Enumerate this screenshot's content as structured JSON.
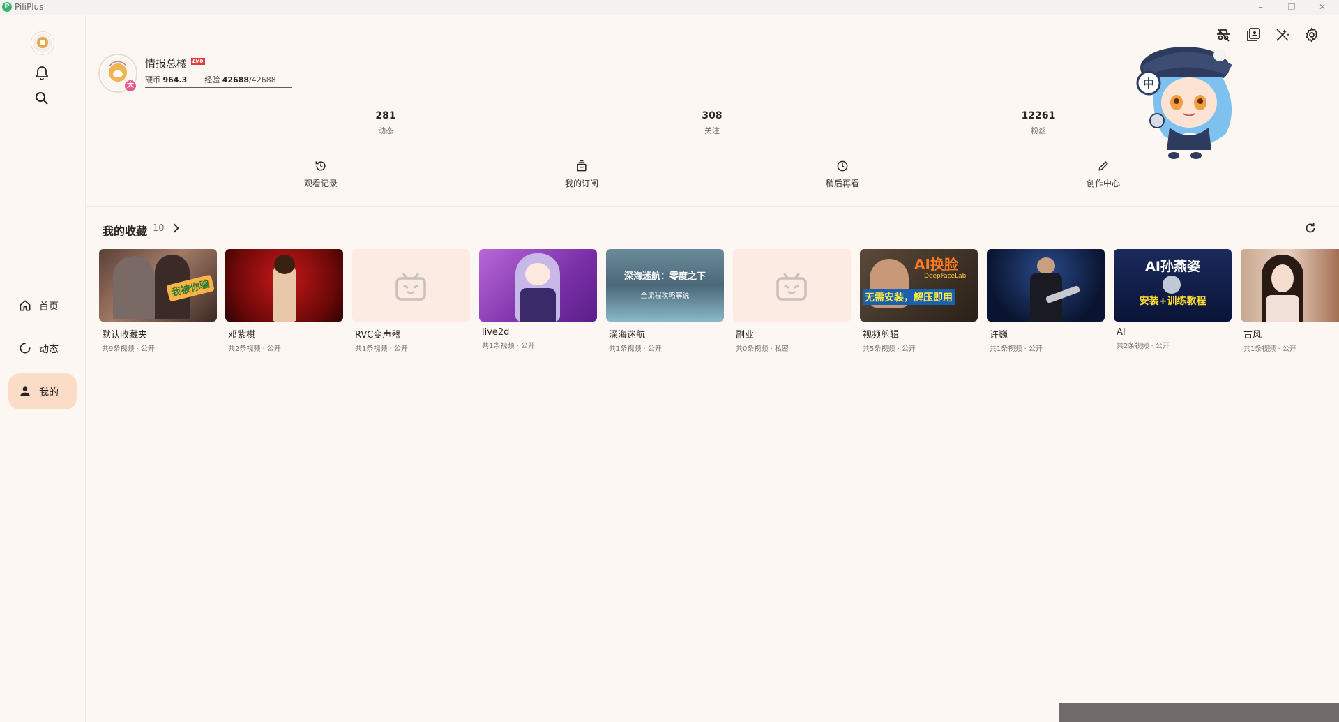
{
  "window": {
    "title": "PiliPlus"
  },
  "sidebar": {
    "nav": [
      {
        "label": "首页",
        "icon": "home-icon"
      },
      {
        "label": "动态",
        "icon": "dynamic-icon"
      },
      {
        "label": "我的",
        "icon": "person-icon",
        "active": true
      }
    ]
  },
  "profile": {
    "name": "情报总橘",
    "level_badge": "LV6",
    "avatar_badge": "大",
    "coins_label": "硬币",
    "coins": "964.3",
    "exp_label": "经验",
    "exp_current": "42688",
    "exp_total": "/42688",
    "exp_progress": 1.0
  },
  "stats": [
    {
      "value": "281",
      "label": "动态"
    },
    {
      "value": "308",
      "label": "关注"
    },
    {
      "value": "12261",
      "label": "粉丝"
    }
  ],
  "quick_actions": [
    {
      "label": "观看记录",
      "icon": "history-icon"
    },
    {
      "label": "我的订阅",
      "icon": "subscription-icon"
    },
    {
      "label": "稍后再看",
      "icon": "clock-icon"
    },
    {
      "label": "创作中心",
      "icon": "pencil-icon"
    }
  ],
  "favorites": {
    "title": "我的收藏",
    "count": "10",
    "items": [
      {
        "title": "默认收藏夹",
        "subtitle": "共9条视频 · 公开"
      },
      {
        "title": "邓紫棋",
        "subtitle": "共2条视频 · 公开"
      },
      {
        "title": "RVC变声器",
        "subtitle": "共1条视频 · 公开"
      },
      {
        "title": "live2d",
        "subtitle": "共1条视频 · 公开"
      },
      {
        "title": "深海迷航",
        "subtitle": "共1条视频 · 公开"
      },
      {
        "title": "副业",
        "subtitle": "共0条视频 · 私密"
      },
      {
        "title": "视频剪辑",
        "subtitle": "共5条视频 · 公开"
      },
      {
        "title": "许巍",
        "subtitle": "共1条视频 · 公开"
      },
      {
        "title": "AI",
        "subtitle": "共2条视频 · 公开"
      },
      {
        "title": "古风",
        "subtitle": "共1条视频 · 公开"
      }
    ],
    "thumb_texts": {
      "t1": "我被你骗",
      "t5a": "深海迷航：零度之下",
      "t5b": "全流程攻略解说",
      "t7a": "AI换脸",
      "t7b": "DeepFaceLab",
      "t7c": "无需安装，解压即用",
      "t9a": "AI孙燕姿",
      "t9b": "安装+训练教程"
    }
  },
  "mascot_badge": "中",
  "colors": {
    "accent": "#fbdcc7",
    "background": "#fdf7f4"
  }
}
